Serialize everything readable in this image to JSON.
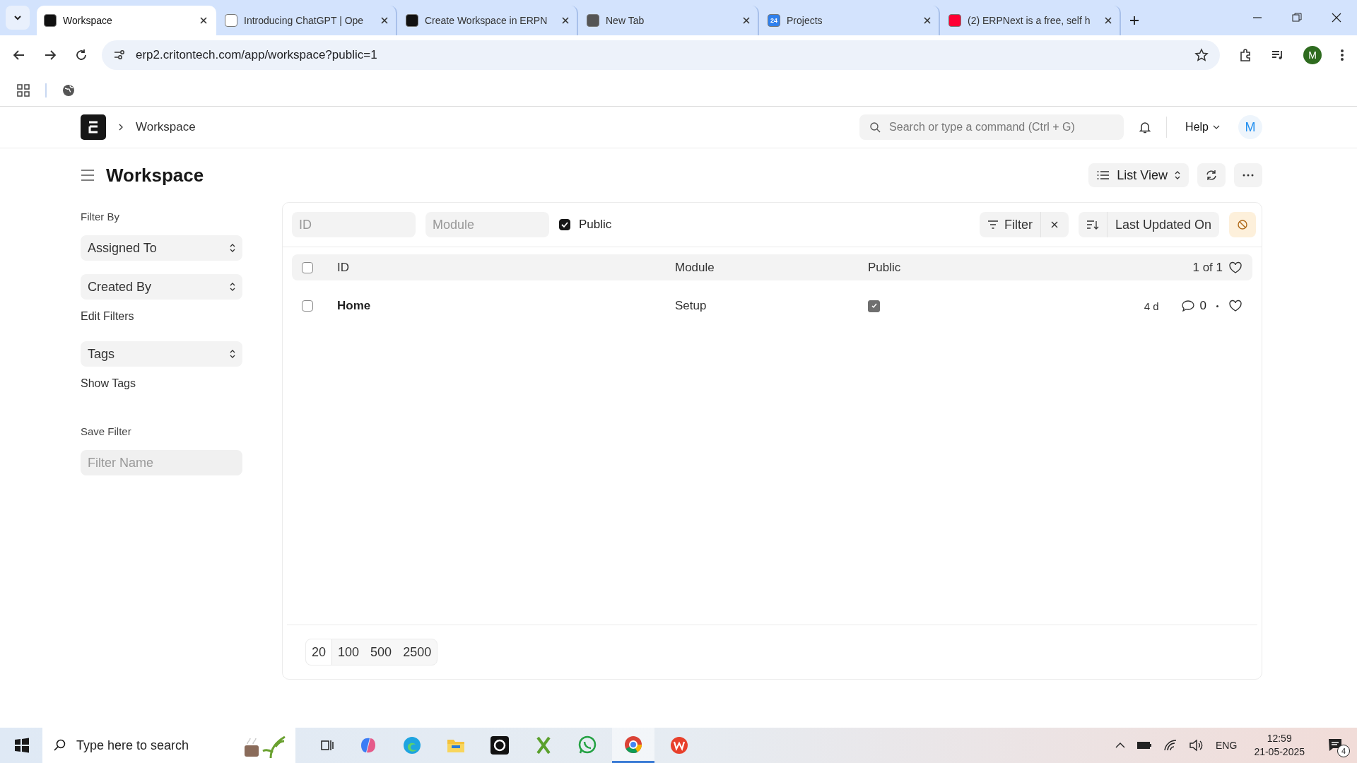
{
  "browser": {
    "tabs": [
      {
        "title": "Workspace",
        "selected": true
      },
      {
        "title": "Introducing ChatGPT | Ope",
        "selected": false
      },
      {
        "title": "Create Workspace in ERPN",
        "selected": false
      },
      {
        "title": "New Tab",
        "selected": false
      },
      {
        "title": "Projects",
        "badge": "24",
        "selected": false
      },
      {
        "title": "(2) ERPNext is a free, self h",
        "selected": false
      }
    ],
    "address": "erp2.critontech.com/app/workspace?public=1",
    "profile_initial": "M"
  },
  "navbar": {
    "breadcrumb": "Workspace",
    "search_placeholder": "Search or type a command (Ctrl + G)",
    "help": "Help",
    "avatar": "M"
  },
  "page": {
    "title": "Workspace",
    "view_button": "List View"
  },
  "sidebar": {
    "items": [
      {
        "kind": "heading",
        "label": "Filter By"
      },
      {
        "kind": "select",
        "label": "Assigned To"
      },
      {
        "kind": "select",
        "label": "Created By"
      },
      {
        "kind": "link",
        "label": "Edit Filters"
      },
      {
        "kind": "select",
        "label": "Tags"
      },
      {
        "kind": "link",
        "label": "Show Tags"
      },
      {
        "kind": "heading",
        "label": "Save Filter"
      },
      {
        "kind": "input",
        "placeholder": "Filter Name"
      }
    ]
  },
  "list": {
    "id_placeholder": "ID",
    "module_placeholder": "Module",
    "public_filter": {
      "label": "Public",
      "checked": true
    },
    "filter_button": "Filter",
    "sort_label": "Last Updated On",
    "select_all": {
      "checked": false
    },
    "columns": [
      "ID",
      "Module",
      "Public"
    ],
    "count": "1 of 1",
    "rows": [
      {
        "id": "Home",
        "module": "Setup",
        "public": true,
        "selected": false,
        "modified": "4 d",
        "comments": "0"
      }
    ],
    "page_sizes": [
      {
        "label": "20",
        "selected": true
      },
      {
        "label": "100",
        "selected": false
      },
      {
        "label": "500",
        "selected": false
      },
      {
        "label": "2500",
        "selected": false
      }
    ]
  },
  "taskbar": {
    "search_placeholder": "Type here to search",
    "language": "ENG",
    "time": "12:59",
    "date": "21-05-2025",
    "notifications": "4"
  }
}
